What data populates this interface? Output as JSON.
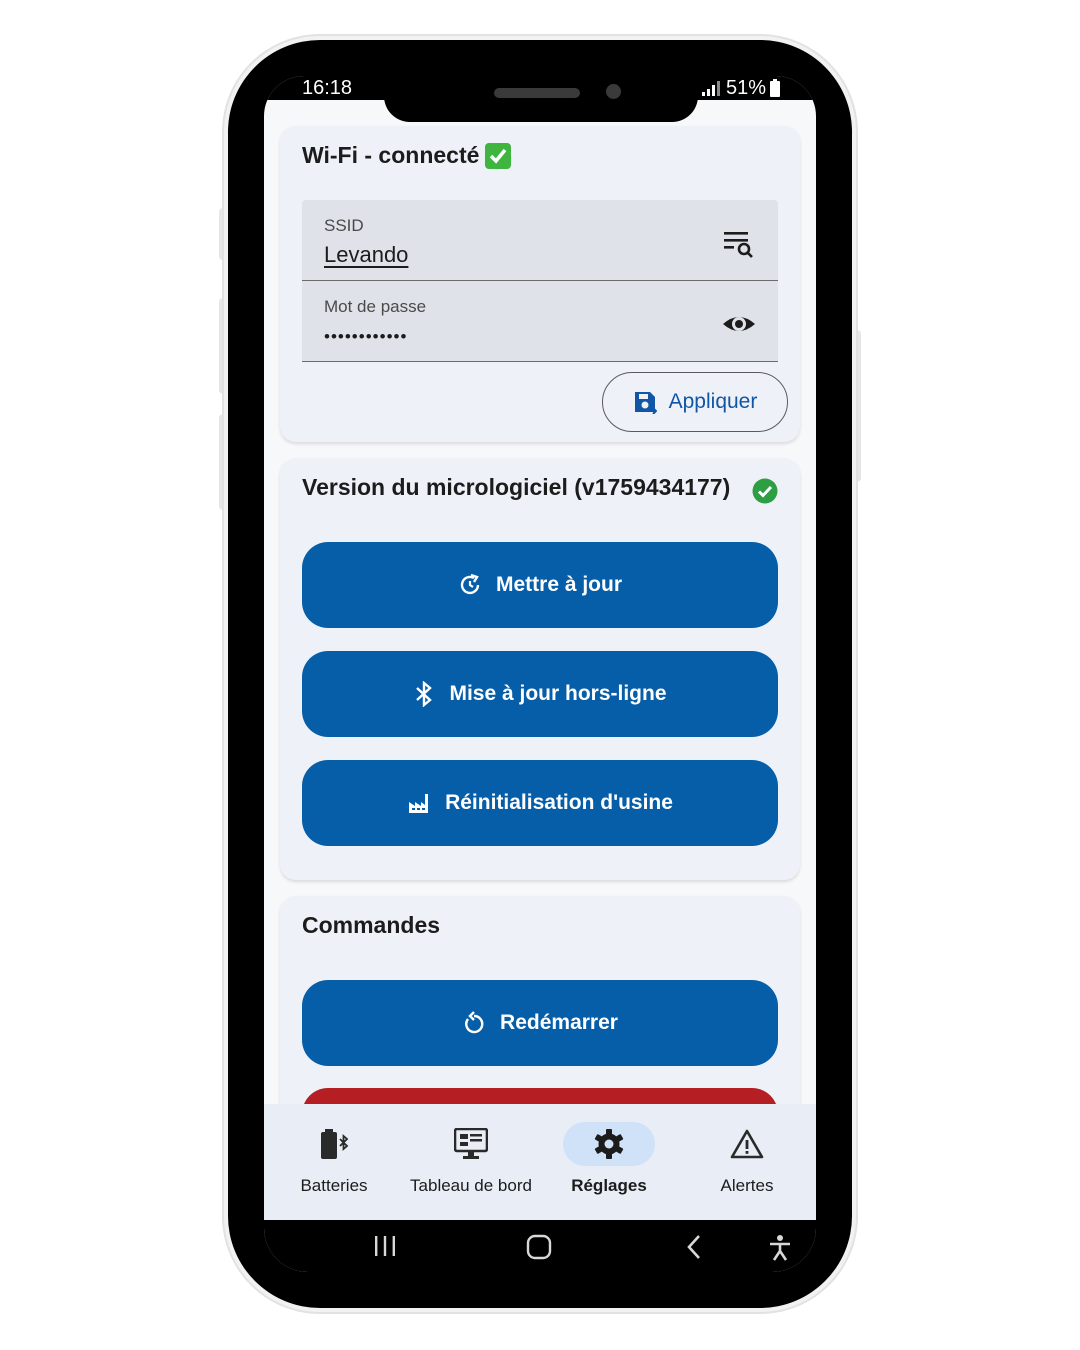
{
  "status_bar": {
    "time": "16:18",
    "battery": "51%"
  },
  "wifi_card": {
    "title": "Wi-Fi - connecté",
    "check_emoji": "✅",
    "ssid_label": "SSID",
    "ssid_value": "Levando",
    "password_label": "Mot de passe",
    "password_value": "••••••••••••",
    "apply_label": "Appliquer"
  },
  "firmware_card": {
    "title": "Version du micrologiciel (v1759434177)",
    "status_color": "#2e9e44",
    "buttons": [
      {
        "label": "Mettre à jour",
        "icon": "update-icon"
      },
      {
        "label": "Mise à jour hors-ligne",
        "icon": "bluetooth-icon"
      },
      {
        "label": "Réinitialisation d'usine",
        "icon": "factory-icon"
      }
    ]
  },
  "commands_card": {
    "title": "Commandes",
    "buttons": [
      {
        "label": "Redémarrer",
        "icon": "restart-icon"
      }
    ],
    "danger_color": "#b51f24"
  },
  "bottom_nav": {
    "items": [
      {
        "label": "Batteries",
        "icon": "battery-bluetooth-icon",
        "active": false
      },
      {
        "label": "Tableau de bord",
        "icon": "dashboard-icon",
        "active": false
      },
      {
        "label": "Réglages",
        "icon": "gear-icon",
        "active": true
      },
      {
        "label": "Alertes",
        "icon": "warning-icon",
        "active": false
      }
    ]
  },
  "colors": {
    "primary": "#075ea8",
    "accent_text": "#1155a6",
    "card_bg": "#eef2f8",
    "nav_active": "#cfe2f8"
  }
}
